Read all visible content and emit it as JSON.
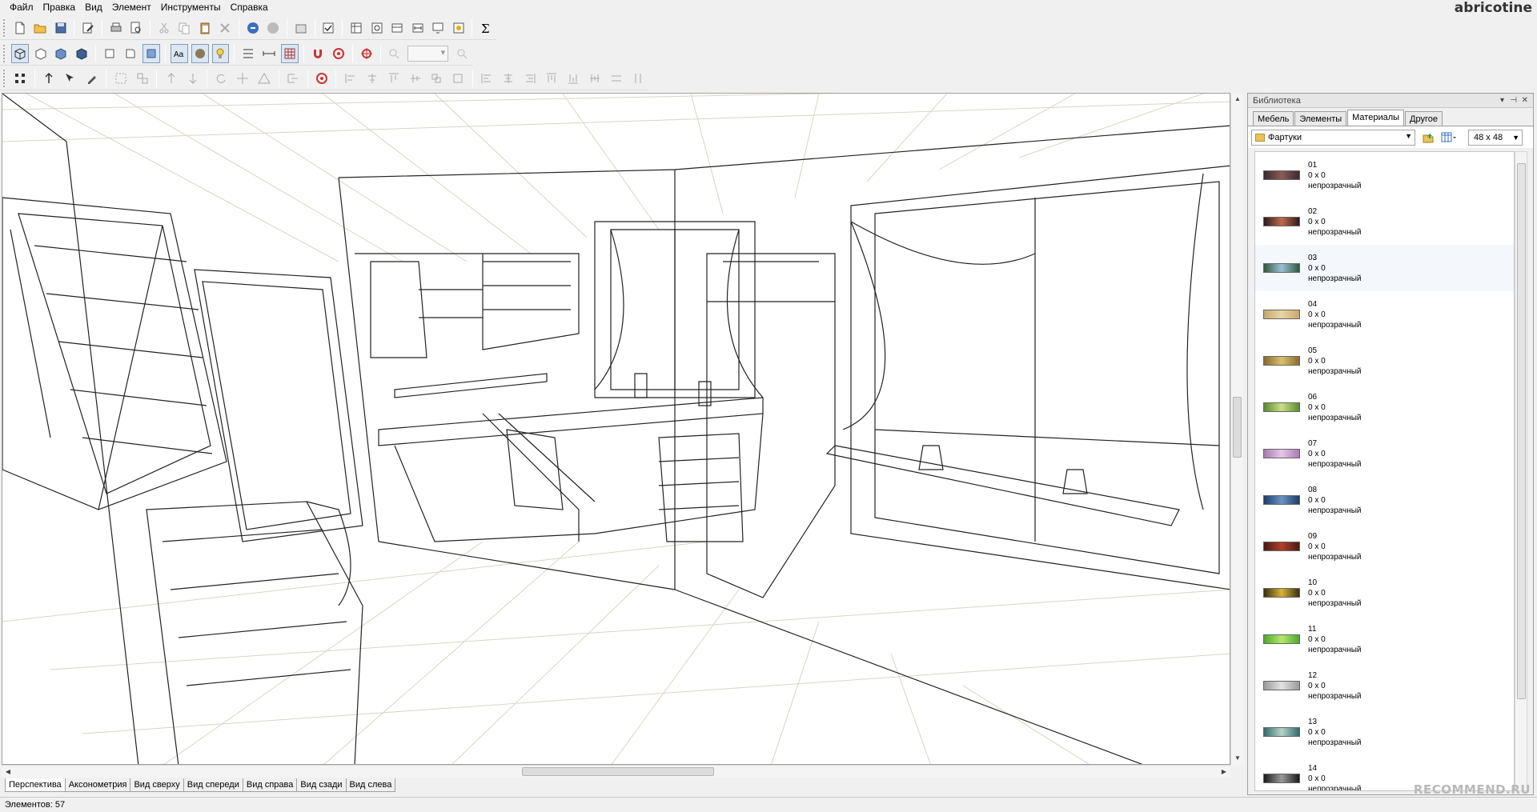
{
  "menu": [
    "Файл",
    "Правка",
    "Вид",
    "Элемент",
    "Инструменты",
    "Справка"
  ],
  "brand": "abricotine",
  "toolbar_icons": {
    "row1": [
      "new-icon",
      "open-icon",
      "save-icon",
      "edit-icon",
      "print-icon",
      "preview-icon",
      "cut-icon",
      "copy-icon",
      "paste-icon",
      "delete-icon",
      "undo-icon",
      "redo-icon",
      "properties-icon",
      "check-icon",
      "sheet-icon",
      "zoom-sheet-icon",
      "box-icon",
      "dimension-icon",
      "display-icon",
      "camera-icon",
      "sum-icon"
    ],
    "row2": [
      "wireframe-icon",
      "box-outline-icon",
      "box-solid-icon",
      "box-dark-icon",
      "front-icon",
      "side-icon",
      "shaded-icon",
      "text-icon",
      "sphere-icon",
      "bulb-icon",
      "grid-a-icon",
      "ruler-icon",
      "grid-icon",
      "magnet-icon",
      "target-icon",
      "crosshair-icon",
      "zoom-in-icon",
      "zoom-out-icon"
    ],
    "row3": [
      "select-icon",
      "move-up-icon",
      "move-icon",
      "pen-icon",
      "group-icon",
      "ungroup-icon",
      "arrow-up-icon",
      "arrow-down-icon",
      "rotate-icon",
      "move-cross-icon",
      "warning-icon",
      "hierarchy-icon",
      "lock-icon",
      "align-1-icon",
      "align-2-icon",
      "align-3-icon",
      "align-4-icon",
      "align-5-icon",
      "align-6-icon",
      "align-7-icon",
      "align-8-icon",
      "align-9-icon",
      "align-10-icon",
      "align-11-icon",
      "align-12-icon",
      "align-13-icon",
      "align-14-icon"
    ]
  },
  "view_tabs": [
    "Перспектива",
    "Аксонометрия",
    "Вид сверху",
    "Вид спереди",
    "Вид справа",
    "Вид сзади",
    "Вид слева"
  ],
  "active_view": "Перспектива",
  "status": "Элементов: 57",
  "library": {
    "title": "Библиотека",
    "tabs": [
      "Мебель",
      "Элементы",
      "Материалы",
      "Другое"
    ],
    "active_tab": "Материалы",
    "folder": "Фартуки",
    "size": "48 x 48",
    "items": [
      {
        "name": "01",
        "dims": "0 x 0",
        "type": "непрозрачный",
        "c1": "#3b2a2a",
        "c2": "#8c5a5a"
      },
      {
        "name": "02",
        "dims": "0 x 0",
        "type": "непрозрачный",
        "c1": "#2d1b18",
        "c2": "#c06a4e"
      },
      {
        "name": "03",
        "dims": "0 x 0",
        "type": "непрозрачный",
        "c1": "#2e5a3a",
        "c2": "#9ec1d8"
      },
      {
        "name": "04",
        "dims": "0 x 0",
        "type": "непрозрачный",
        "c1": "#c9a66b",
        "c2": "#e8d6a6"
      },
      {
        "name": "05",
        "dims": "0 x 0",
        "type": "непрозрачный",
        "c1": "#8a6b2a",
        "c2": "#d8c070"
      },
      {
        "name": "06",
        "dims": "0 x 0",
        "type": "непрозрачный",
        "c1": "#5b8a2e",
        "c2": "#c9e08a"
      },
      {
        "name": "07",
        "dims": "0 x 0",
        "type": "непрозрачный",
        "c1": "#a87ab0",
        "c2": "#e6c8e8"
      },
      {
        "name": "08",
        "dims": "0 x 0",
        "type": "непрозрачный",
        "c1": "#1e3d6b",
        "c2": "#6a94c4"
      },
      {
        "name": "09",
        "dims": "0 x 0",
        "type": "непрозрачный",
        "c1": "#4a1a12",
        "c2": "#b0402a"
      },
      {
        "name": "10",
        "dims": "0 x 0",
        "type": "непрозрачный",
        "c1": "#3a2e0e",
        "c2": "#d8b43a"
      },
      {
        "name": "11",
        "dims": "0 x 0",
        "type": "непрозрачный",
        "c1": "#4ea82a",
        "c2": "#b6e86a"
      },
      {
        "name": "12",
        "dims": "0 x 0",
        "type": "непрозрачный",
        "c1": "#9a9a9a",
        "c2": "#e2e2e2"
      },
      {
        "name": "13",
        "dims": "0 x 0",
        "type": "непрозрачный",
        "c1": "#2f6b6b",
        "c2": "#b7d2c8"
      },
      {
        "name": "14",
        "dims": "0 x 0",
        "type": "непрозрачный",
        "c1": "#1a1a1a",
        "c2": "#9a9a9a"
      }
    ]
  },
  "watermark": "RECOMMEND.RU"
}
